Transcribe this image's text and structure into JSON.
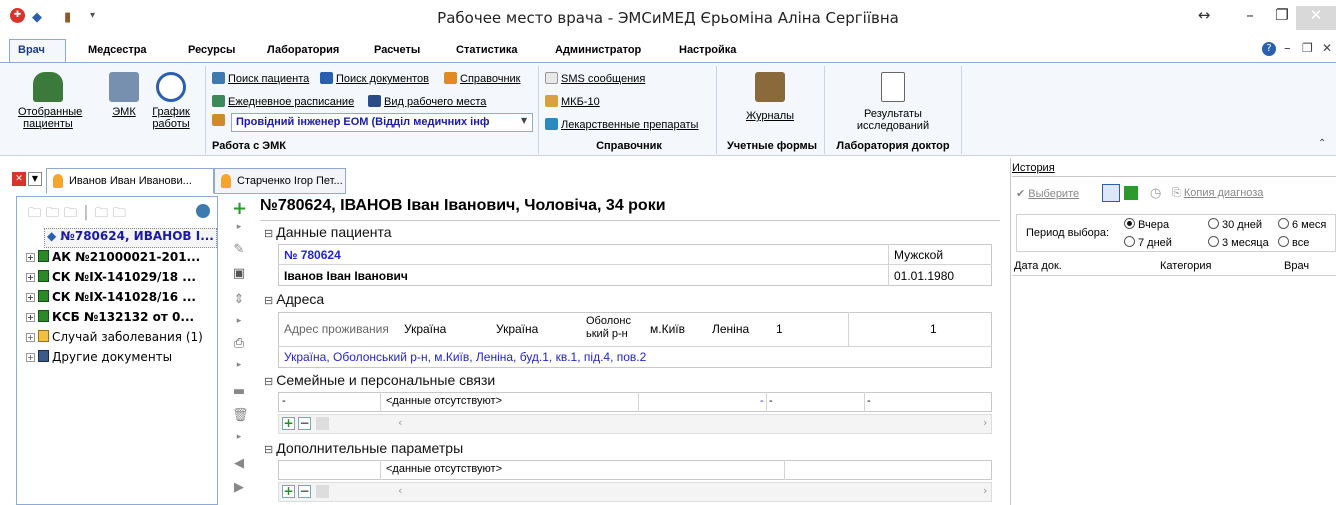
{
  "window": {
    "title": "Рабочее место врача - ЭМСиМЕД Єрьоміна Аліна Сергіївна"
  },
  "menu": [
    "Врач",
    "Медсестра",
    "Ресурсы",
    "Лаборатория",
    "Расчеты",
    "Статистика",
    "Администратор",
    "Настройка"
  ],
  "ribbon": {
    "group1": {
      "selected_patients": "Отобранные\nпациенты",
      "emk": "ЭМК",
      "schedule": "График\nработы"
    },
    "group2": {
      "search_patient": "Поиск пациента",
      "search_docs": "Поиск документов",
      "reference": "Справочник",
      "daily_schedule": "Ежедневное расписание",
      "workplace_view": "Вид рабочего места",
      "position_select": "Провідний інженер ЕОМ (Відділ медичних інф",
      "label": "Работа с ЭМК"
    },
    "group3": {
      "sms": "SMS сообщения",
      "mkb": "МКБ-10",
      "drugs": "Лекарственные препараты",
      "label": "Справочник"
    },
    "group4": {
      "journals": "Журналы",
      "label": "Учетные формы"
    },
    "group5": {
      "results": "Результаты\nисследований",
      "label": "Лаборатория доктор"
    }
  },
  "tabs": [
    "Иванов Иван Иванови...",
    "Старченко Ігор Пет..."
  ],
  "tree": [
    {
      "label": "№780624, ИВАНОВ І...",
      "selected": true,
      "bold": true
    },
    {
      "label": "АК №21000021-201...",
      "bold": true
    },
    {
      "label": "СК №IX-141029/18 ...",
      "bold": true
    },
    {
      "label": "СК №IX-141028/16 ...",
      "bold": true
    },
    {
      "label": "КСБ №132132  от 0...",
      "bold": true
    },
    {
      "label": "Случай заболевания (1)",
      "bold": false
    },
    {
      "label": "Другие документы",
      "bold": false
    }
  ],
  "patient": {
    "header": "№780624, ІВАНОВ Іван Іванович, Чоловіча, 34 роки",
    "section_data": "Данные пациента",
    "number": "№ 780624",
    "gender": "Мужской",
    "fullname": "Іванов Іван Іванович",
    "birthdate": "01.01.1980",
    "section_address": "Адреса",
    "address_label": "Адрес проживания",
    "addr_country1": "Україна",
    "addr_country2": "Україна",
    "addr_district": "Оболонс\nький р-н",
    "addr_city": "м.Київ",
    "addr_street": "Леніна",
    "addr_house": "1",
    "addr_flat": "1",
    "address_full": "Україна, Оболонський р-н, м.Київ, Леніна, буд.1, кв.1, під.4, пов.2",
    "section_family": "Семейные и персональные связи",
    "family_dash": "-",
    "no_data": "<данные отсутствуют>",
    "dash": "-",
    "section_extra": "Дополнительные параметры"
  },
  "history": {
    "title": "История",
    "choose": "Выберите",
    "copy_diagnosis": "Копия диагноза",
    "period_label": "Период выбора:",
    "periods": [
      "Вчера",
      "30 дней",
      "6 меся",
      "7 дней",
      "3 месяца",
      "все"
    ],
    "columns": [
      "Дата док.",
      "Категория",
      "Врач"
    ]
  },
  "colors": {
    "accent": "#2323d4",
    "ribbon_bg": "#f4f7fb",
    "border": "#8faad2"
  }
}
